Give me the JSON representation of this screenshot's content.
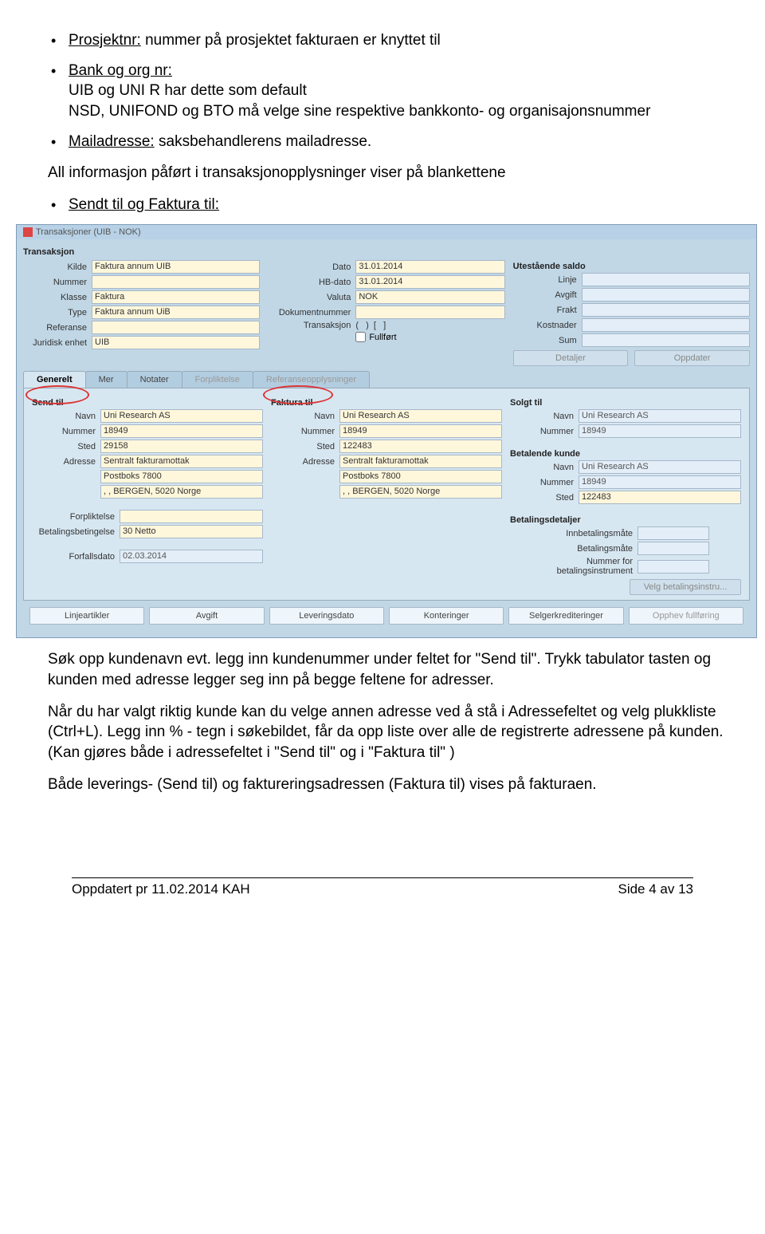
{
  "doc": {
    "bullet1_label": "Prosjektnr:",
    "bullet1_rest": " nummer på prosjektet fakturaen er knyttet til",
    "bullet2_label": "Bank og org nr:",
    "bullet2_l1": "UIB og UNI R har dette som default",
    "bullet2_l2": "NSD, UNIFOND og BTO må velge sine respektive bankkonto- og organisajonsnummer",
    "bullet3_label": "Mailadresse:",
    "bullet3_rest": " saksbehandlerens mailadresse.",
    "para1": "All informasjon påført i transaksjonopplysninger viser på blankettene",
    "bullet4": "Sendt til og Faktura til:",
    "para2": "Søk opp kundenavn evt. legg inn kundenummer under feltet for \"Send til\". Trykk tabulator tasten og kunden med adresse legger seg inn på begge feltene for adresser.",
    "para3": "Når du har valgt riktig kunde kan du velge annen adresse ved å stå i Adressefeltet og velg plukkliste (Ctrl+L). Legg inn % - tegn i søkebildet, får da opp liste over alle de registrerte adressene på kunden. (Kan gjøres både i adressefeltet i \"Send til\" og i \"Faktura til\" )",
    "para4": "Både leverings- (Send til) og faktureringsadressen (Faktura til) vises på fakturaen."
  },
  "shot": {
    "title": "Transaksjoner (UIB - NOK)",
    "transaksjon_head": "Transaksjon",
    "col1": {
      "kilde": {
        "lbl": "Kilde",
        "val": "Faktura annum UIB"
      },
      "nummer": {
        "lbl": "Nummer",
        "val": ""
      },
      "klasse": {
        "lbl": "Klasse",
        "val": "Faktura"
      },
      "type": {
        "lbl": "Type",
        "val": "Faktura annum UiB"
      },
      "referanse": {
        "lbl": "Referanse",
        "val": ""
      },
      "juridisk": {
        "lbl": "Juridisk enhet",
        "val": "UIB"
      }
    },
    "col2": {
      "dato": {
        "lbl": "Dato",
        "val": "31.01.2014"
      },
      "hbdato": {
        "lbl": "HB-dato",
        "val": "31.01.2014"
      },
      "valuta": {
        "lbl": "Valuta",
        "val": "NOK"
      },
      "doknr": {
        "lbl": "Dokumentnummer",
        "val": ""
      },
      "transaksjon": {
        "lbl": "Transaksjon"
      },
      "fullfort": "Fullført"
    },
    "col3_head": "Utestående saldo",
    "col3": {
      "linje": "Linje",
      "avgift": "Avgift",
      "frakt": "Frakt",
      "kostnader": "Kostnader",
      "sum": "Sum",
      "btn_detaljer": "Detaljer",
      "btn_oppdater": "Oppdater"
    },
    "tabs": {
      "generelt": "Generelt",
      "mer": "Mer",
      "notater": "Notater",
      "forpliktelse": "Forpliktelse",
      "refopp": "Referanseopplysninger"
    },
    "send_til_head": "Send til",
    "faktura_til_head": "Faktura til",
    "solgt_til_head": "Solgt til",
    "betalende_head": "Betalende kunde",
    "betdet_head": "Betalingsdetaljer",
    "fields": {
      "navn": "Navn",
      "nummer": "Nummer",
      "sted": "Sted",
      "adresse": "Adresse",
      "uniresearch": "Uni Research AS",
      "n18949": "18949",
      "sted29158": "29158",
      "sted122483": "122483",
      "adr1": "Sentralt fakturamottak",
      "adr2": "Postboks 7800",
      "adr3": ", , BERGEN, 5020 Norge",
      "forpliktelse": "Forpliktelse",
      "betbet": "Betalingsbetingelse",
      "betbet_val": "30 Netto",
      "forfall": "Forfallsdato",
      "forfall_val": "02.03.2014",
      "innbet": "Innbetalingsmåte",
      "betmate": "Betalingsmåte",
      "nrbet": "Nummer for betalingsinstrument",
      "velgbet": "Velg betalingsinstru..."
    },
    "translinks": {
      "l1": "Linjeartikler",
      "l2": "Avgift",
      "l3": "Leveringsdato",
      "l4": "Konteringer",
      "l5": "Selgerkrediteringer",
      "l6": "Opphev fullføring"
    }
  },
  "footer": {
    "left": "Oppdatert pr 11.02.2014 KAH",
    "right": "Side 4 av 13"
  }
}
